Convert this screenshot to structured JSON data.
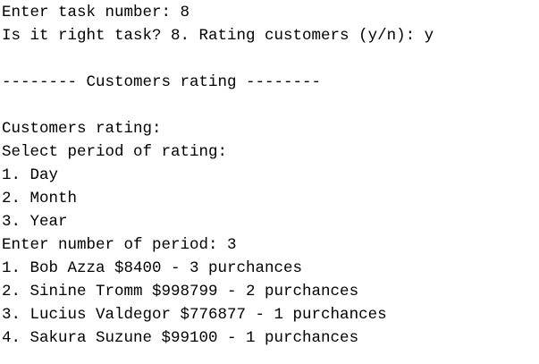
{
  "console": {
    "lines": [
      "Enter task number: 8",
      "Is it right task? 8. Rating customers (y/n): y",
      "",
      "-------- Customers rating --------",
      "",
      "Customers rating:",
      "Select period of rating:",
      "1. Day",
      "2. Month",
      "3. Year",
      "Enter number of period: 3",
      "1. Bob Azza $8400 - 3 purchances",
      "2. Sinine Tromm $998799 - 2 purchances",
      "3. Lucius Valdegor $776877 - 1 purchances",
      "4. Sakura Suzune $99100 - 1 purchances"
    ]
  }
}
